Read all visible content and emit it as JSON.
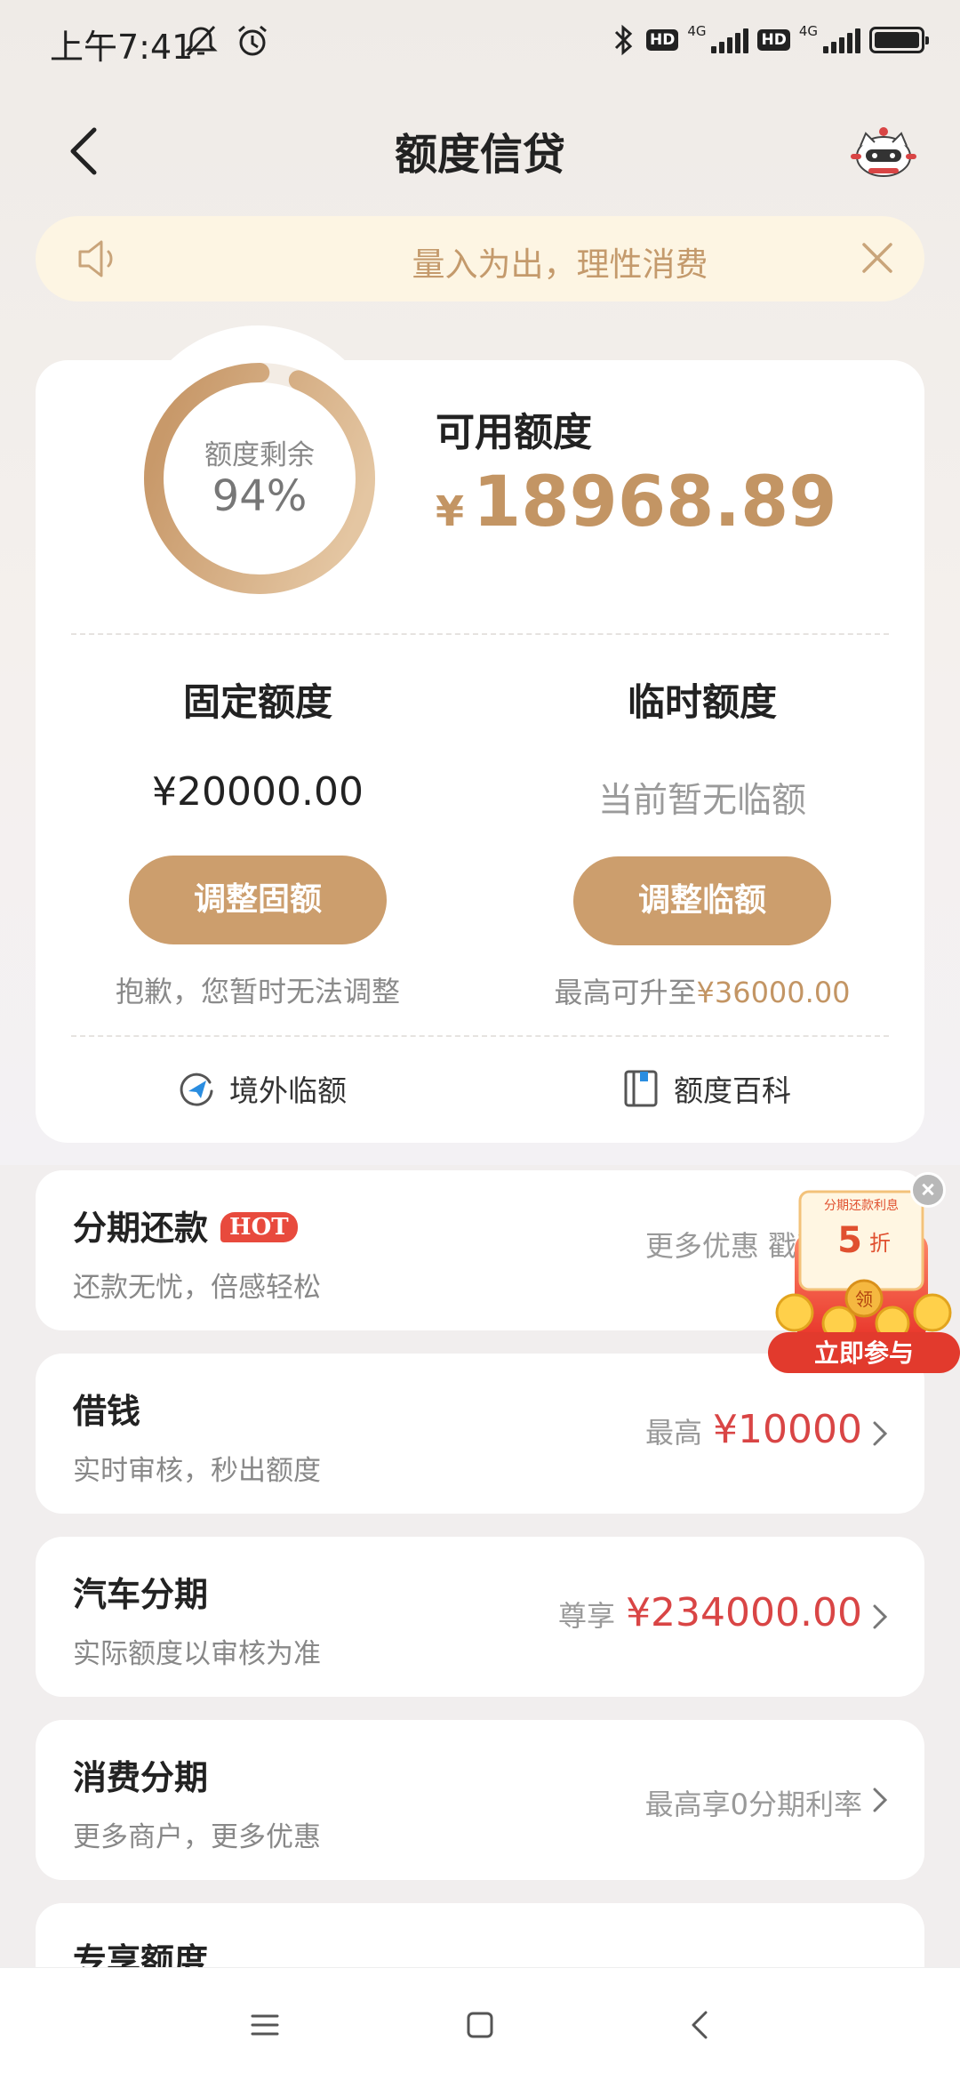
{
  "status_bar": {
    "time": "上午7:41",
    "network": "4G",
    "hd": "HD"
  },
  "header": {
    "title": "额度信贷"
  },
  "notice": {
    "text": "量入为出，理性消费"
  },
  "credit": {
    "ring_label": "额度剩余",
    "ring_value": "94%",
    "ring_fraction": 0.94,
    "available_label": "可用额度",
    "currency": "¥",
    "available_amount": "18968.89",
    "fixed": {
      "title": "固定额度",
      "amount": "¥20000.00",
      "button": "调整固额",
      "note": "抱歉，您暂时无法调整"
    },
    "temporary": {
      "title": "临时额度",
      "status": "当前暂无临额",
      "button": "调整临额",
      "note_prefix": "最高可升至",
      "note_amount": "¥36000.00"
    },
    "links": [
      {
        "label": "境外临额",
        "icon": "overseas-icon"
      },
      {
        "label": "额度百科",
        "icon": "book-icon"
      }
    ]
  },
  "services": [
    {
      "title": "分期还款",
      "badge": "HOT",
      "subtitle": "还款无忧，倍感轻松",
      "right_text": "更多优惠 戳我参"
    },
    {
      "title": "借钱",
      "subtitle": "实时审核，秒出额度",
      "right_prefix": "最高",
      "right_amount": "¥10000"
    },
    {
      "title": "汽车分期",
      "subtitle": "实际额度以审核为准",
      "right_prefix": "尊享",
      "right_amount": "¥234000.00"
    },
    {
      "title": "消费分期",
      "subtitle": "更多商户，更多优惠",
      "right_text": "最高享0分期利率"
    },
    {
      "title": "专享额度"
    }
  ],
  "promo": {
    "top_text": "分期还款利息",
    "big": "5",
    "unit": "折",
    "coin": "领",
    "cta": "立即参与"
  },
  "colors": {
    "gold": "#cc9e6d",
    "gold_text": "#c39564",
    "red": "#d94545",
    "notice_bg": "#fdf5e3"
  }
}
